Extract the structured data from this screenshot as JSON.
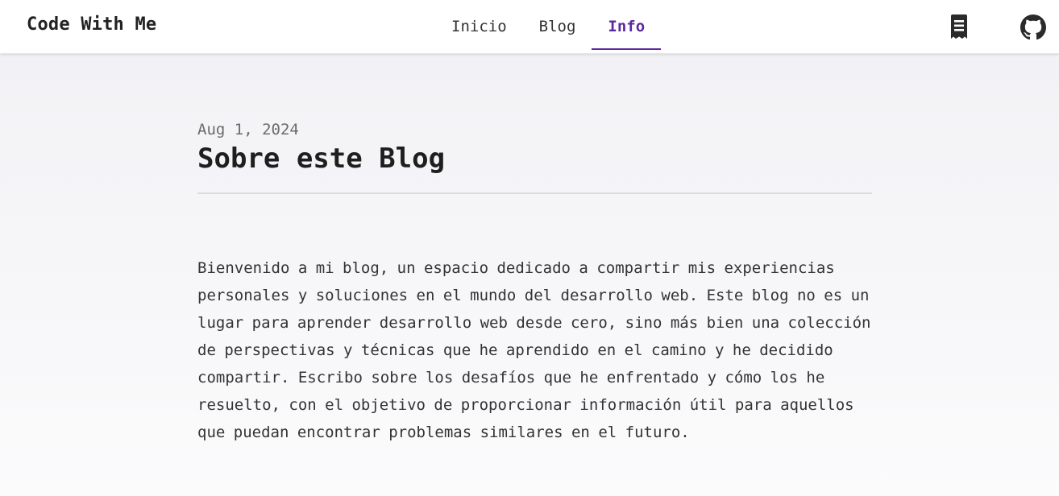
{
  "header": {
    "brand": "Code With Me",
    "nav": [
      {
        "label": "Inicio",
        "active": false
      },
      {
        "label": "Blog",
        "active": false
      },
      {
        "label": "Info",
        "active": true
      }
    ],
    "icons": [
      "receipt-icon",
      "github-icon"
    ],
    "accent_color": "#5b2aa0"
  },
  "post": {
    "date": "Aug 1, 2024",
    "title": "Sobre este Blog",
    "body": "Bienvenido a mi blog, un espacio dedicado a compartir mis experiencias personales y soluciones en el mundo del desarrollo web. Este blog no es un lugar para aprender desarrollo web desde cero, sino más bien una colección de perspectivas y técnicas que he aprendido en el camino y he decidido compartir. Escribo sobre los desafíos que he enfrentado y cómo los he resuelto, con el objetivo de proporcionar información útil para aquellos que puedan encontrar problemas similares en el futuro."
  }
}
